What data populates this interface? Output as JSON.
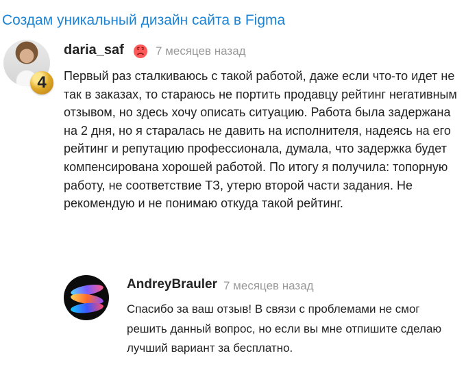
{
  "page": {
    "title": "Создам уникальный дизайн сайта в Figma"
  },
  "review": {
    "username": "daria_saf",
    "badge_number": "4",
    "time": "7 месяцев назад",
    "text": "Первый раз сталкиваюсь с такой работой, даже если что-то идет не так в заказах, то стараюсь не портить продавцу рейтинг негативным отзывом, но здесь хочу описать ситуацию. Работа была задержана на 2 дня, но я старалась не давить на исполнителя, надеясь на его рейтинг и репутацию профессионала, думала, что задержка будет компенсирована хорошей работой. По итогу я получила: топорную работу, не соответствие ТЗ, утерю второй части задания. Не рекомендую и не понимаю откуда такой рейтинг.",
    "status_icon": "sad-face-icon",
    "status_color": "#ff4d4d"
  },
  "reply": {
    "username": "AndreyBrauler",
    "time": "7 месяцев назад",
    "text": "Спасибо за ваш отзыв! В связи с проблемами не смог решить данный вопрос, но если вы мне отпишите сделаю лучший вариант за бесплатно."
  },
  "colors": {
    "accent": "#1b83d4",
    "muted": "#9a9a9a",
    "text": "#222222"
  }
}
